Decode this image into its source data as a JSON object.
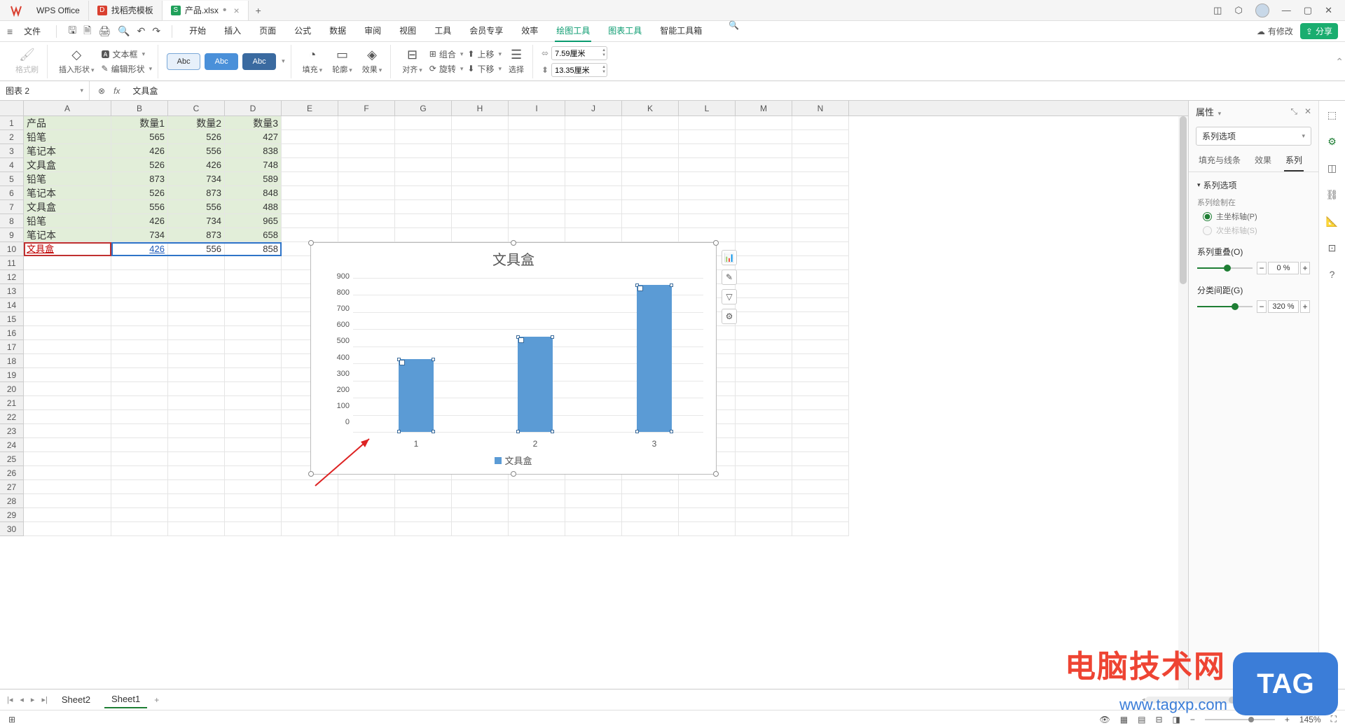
{
  "titlebar": {
    "app_name": "WPS Office",
    "tab1": "找稻壳模板",
    "tab2": "产品.xlsx",
    "newtab": "+"
  },
  "menubar": {
    "file": "文件",
    "tabs": [
      "开始",
      "插入",
      "页面",
      "公式",
      "数据",
      "审阅",
      "视图",
      "工具",
      "会员专享",
      "效率",
      "绘图工具",
      "图表工具",
      "智能工具箱"
    ],
    "modify": "有修改",
    "share": "分享"
  },
  "ribbon": {
    "format_brush": "格式刷",
    "insert_shape": "插入形状",
    "text_box": "文本框",
    "edit_shape": "编辑形状",
    "style_labels": [
      "Abc",
      "Abc",
      "Abc"
    ],
    "fill": "填充",
    "outline": "轮廓",
    "effect": "效果",
    "align": "对齐",
    "group": "组合",
    "rotate": "旋转",
    "move_up": "上移",
    "move_down": "下移",
    "selection": "选择",
    "width_val": "7.59厘米",
    "height_val": "13.35厘米"
  },
  "formula": {
    "namebox": "图表 2",
    "content": "文具盒"
  },
  "columns": [
    "A",
    "B",
    "C",
    "D",
    "E",
    "F",
    "G",
    "H",
    "I",
    "J",
    "K",
    "L",
    "M",
    "N"
  ],
  "rows": [
    "1",
    "2",
    "3",
    "4",
    "5",
    "6",
    "7",
    "8",
    "9",
    "10",
    "11",
    "12",
    "13",
    "14",
    "15",
    "16",
    "17",
    "18",
    "19",
    "20",
    "21",
    "22",
    "23",
    "24",
    "25",
    "26",
    "27",
    "28",
    "29",
    "30"
  ],
  "table": {
    "headers": [
      "产品",
      "数量1",
      "数量2",
      "数量3"
    ],
    "data": [
      [
        "铅笔",
        "565",
        "526",
        "427"
      ],
      [
        "笔记本",
        "426",
        "556",
        "838"
      ],
      [
        "文具盒",
        "526",
        "426",
        "748"
      ],
      [
        "铅笔",
        "873",
        "734",
        "589"
      ],
      [
        "笔记本",
        "526",
        "873",
        "848"
      ],
      [
        "文具盒",
        "556",
        "556",
        "488"
      ],
      [
        "铅笔",
        "426",
        "734",
        "965"
      ],
      [
        "笔记本",
        "734",
        "873",
        "658"
      ],
      [
        "文具盒",
        "426",
        "556",
        "858"
      ]
    ]
  },
  "chart_data": {
    "type": "bar",
    "title": "文具盒",
    "categories": [
      "1",
      "2",
      "3"
    ],
    "values": [
      426,
      556,
      858
    ],
    "ylabel": "",
    "ylim": [
      0,
      900
    ],
    "yticks": [
      "0",
      "100",
      "200",
      "300",
      "400",
      "500",
      "600",
      "700",
      "800",
      "900"
    ],
    "legend": "文具盒"
  },
  "rpanel": {
    "title": "属性",
    "series_select": "系列选项",
    "tabs": [
      "填充与线条",
      "效果",
      "系列"
    ],
    "section_title": "系列选项",
    "plot_on": "系列绘制在",
    "primary_axis": "主坐标轴(P)",
    "secondary_axis": "次坐标轴(S)",
    "overlap_label": "系列重叠(O)",
    "overlap_val": "0 %",
    "gap_label": "分类间距(G)",
    "gap_val": "320 %"
  },
  "sheets": {
    "sheet2": "Sheet2",
    "sheet1": "Sheet1"
  },
  "status": {
    "zoom": "145%"
  },
  "watermark": {
    "line1": "电脑技术网",
    "line2": "www.tagxp.com",
    "tag": "TAG"
  }
}
